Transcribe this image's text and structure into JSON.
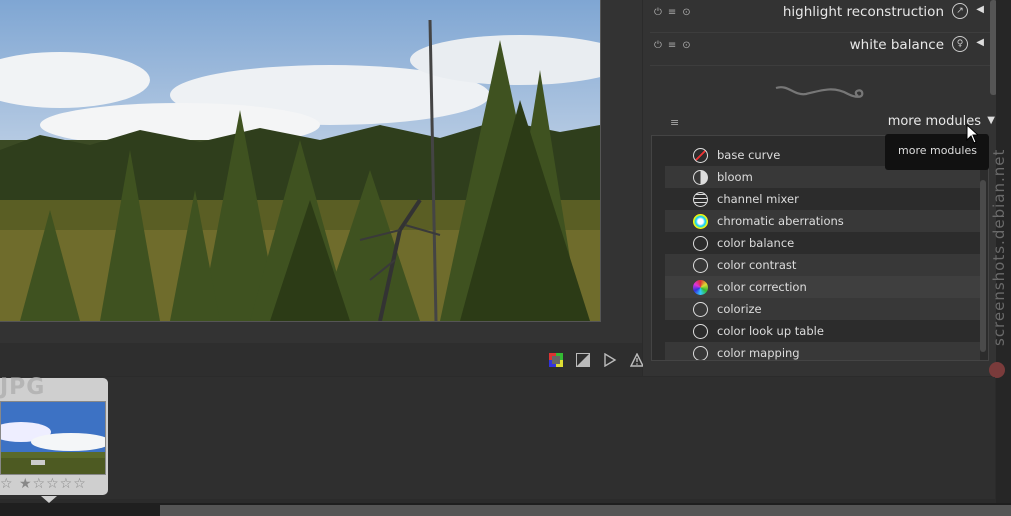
{
  "modules_top": [
    {
      "title": "highlight reconstruction",
      "badge": "↗"
    },
    {
      "title": "white balance",
      "badge": "♀"
    }
  ],
  "more_modules": {
    "label": "more modules",
    "tooltip": "more modules"
  },
  "module_list": [
    {
      "label": "base curve",
      "icon": "base-curve-icon"
    },
    {
      "label": "bloom",
      "icon": "bloom-icon"
    },
    {
      "label": "channel mixer",
      "icon": "channel-mixer-icon"
    },
    {
      "label": "chromatic aberrations",
      "icon": "chromatic-aberrations-icon"
    },
    {
      "label": "color balance",
      "icon": "circle-icon"
    },
    {
      "label": "color contrast",
      "icon": "circle-icon"
    },
    {
      "label": "color correction",
      "icon": "color-correction-icon"
    },
    {
      "label": "colorize",
      "icon": "circle-icon"
    },
    {
      "label": "color look up table",
      "icon": "circle-icon"
    },
    {
      "label": "color mapping",
      "icon": "color-mapping-icon"
    }
  ],
  "filmstrip": {
    "thumb_label": "JPG",
    "rating_stars": "☆ ★☆☆☆☆"
  },
  "watermark": "screenshots.debian.net",
  "colors": {
    "panel_bg": "#333333",
    "accent": "#e8e8e8"
  }
}
